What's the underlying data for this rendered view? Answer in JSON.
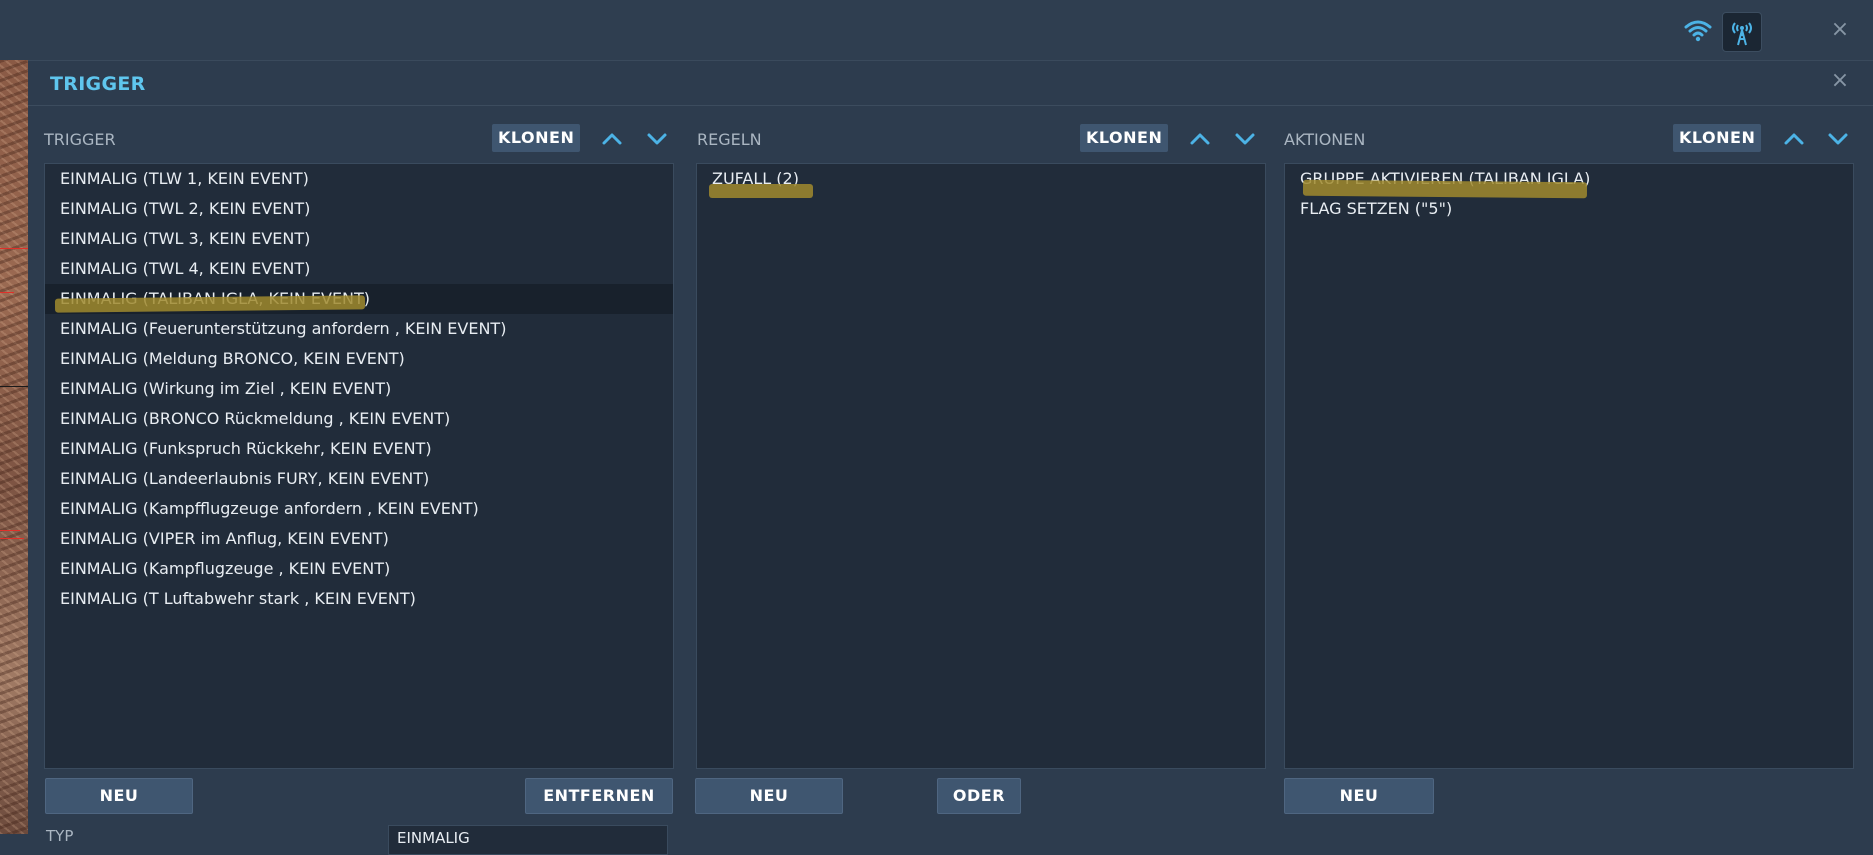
{
  "window": {
    "title": "TRIGGER",
    "close_label": "×",
    "top_close_label": "×"
  },
  "toolbar": {
    "wifi_icon": "wifi-icon",
    "radio_icon": "radio-tower-icon"
  },
  "panels": {
    "trigger": {
      "label": "TRIGGER",
      "clone_label": "KLONEN",
      "items": [
        "EINMALIG (TLW 1, KEIN EVENT)",
        "EINMALIG (TWL 2, KEIN EVENT)",
        "EINMALIG (TWL 3, KEIN EVENT)",
        "EINMALIG (TWL 4, KEIN EVENT)",
        "EINMALIG (TALIBAN IGLA, KEIN EVENT)",
        "EINMALIG (Feuerunterstützung anfordern , KEIN EVENT)",
        "EINMALIG (Meldung  BRONCO, KEIN EVENT)",
        "EINMALIG (Wirkung im Ziel , KEIN EVENT)",
        "EINMALIG (BRONCO Rückmeldung , KEIN EVENT)",
        "EINMALIG (Funkspruch Rückkehr, KEIN EVENT)",
        "EINMALIG (Landeerlaubnis FURY, KEIN EVENT)",
        "EINMALIG (Kampfflugzeuge anfordern , KEIN EVENT)",
        "EINMALIG (VIPER im Anflug, KEIN EVENT)",
        "EINMALIG (Kampflugzeuge  , KEIN EVENT)",
        "EINMALIG (T Luftabwehr stark , KEIN EVENT)"
      ],
      "selected_index": 4,
      "new_label": "NEU",
      "remove_label": "ENTFERNEN"
    },
    "rules": {
      "label": "REGELN",
      "clone_label": "KLONEN",
      "items": [
        "ZUFALL (2)"
      ],
      "new_label": "NEU",
      "or_label": "ODER"
    },
    "actions": {
      "label": "AKTIONEN",
      "clone_label": "KLONEN",
      "items": [
        "GRUPPE AKTIVIEREN (TALIBAN  IGLA)",
        "FLAG SETZEN (\"5\")"
      ],
      "new_label": "NEU"
    }
  },
  "details": {
    "type_label": "TYP",
    "type_value": "EINMALIG"
  },
  "colors": {
    "title": "#5fc6ee",
    "accent_icon": "#4cb3e6",
    "highlight_marker": "#a08a2e",
    "button_bg": "#3f5670",
    "list_bg": "#212c3a"
  }
}
